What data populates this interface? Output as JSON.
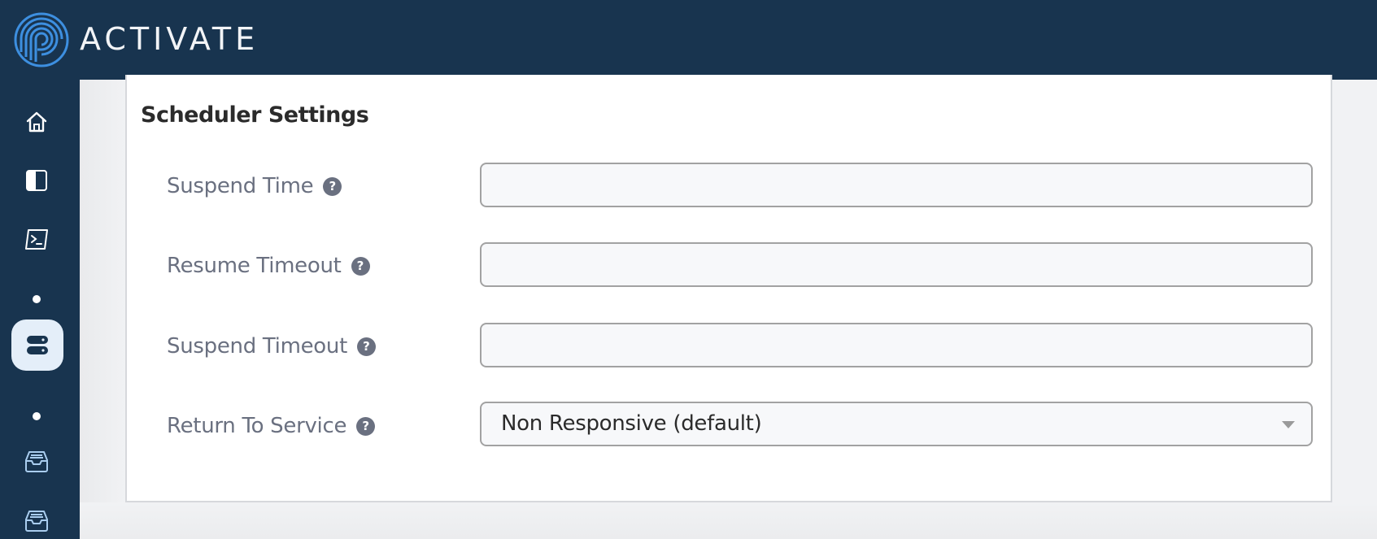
{
  "app": {
    "brand_name": "ACTIVATE",
    "logo_icon": "p-spiral-logo",
    "colors": {
      "header_bg": "#18344f",
      "logo_blue": "#3d8fe0",
      "active_tile": "#e4eef9",
      "label_gray": "#6a7080",
      "field_border": "#a2a2a2"
    }
  },
  "sidebar": {
    "items": [
      {
        "name": "home",
        "icon": "home-icon",
        "active": false
      },
      {
        "name": "sidebar-toggle",
        "icon": "sidebar-panel-icon",
        "active": false
      },
      {
        "name": "terminal",
        "icon": "terminal-icon",
        "active": false
      },
      {
        "name": "servers",
        "icon": "server-icon",
        "active": true
      },
      {
        "name": "storage-1",
        "icon": "inbox-tray-icon",
        "active": false
      },
      {
        "name": "storage-2",
        "icon": "inbox-tray-icon",
        "active": false
      }
    ]
  },
  "section": {
    "title": "Scheduler Settings",
    "fields": [
      {
        "label": "Suspend Time",
        "help_icon": "?",
        "type": "text",
        "value": "",
        "placeholder": ""
      },
      {
        "label": "Resume Timeout",
        "help_icon": "?",
        "type": "text",
        "value": "",
        "placeholder": ""
      },
      {
        "label": "Suspend Timeout",
        "help_icon": "?",
        "type": "text",
        "value": "",
        "placeholder": ""
      },
      {
        "label": "Return To Service",
        "help_icon": "?",
        "type": "select",
        "value": "Non Responsive (default)"
      }
    ]
  }
}
